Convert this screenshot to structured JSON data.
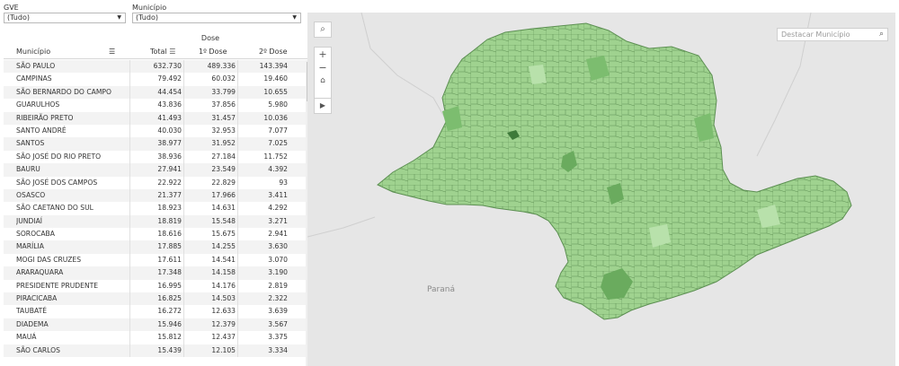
{
  "filters": {
    "gve": {
      "label": "GVE",
      "value": "(Tudo)"
    },
    "municipio": {
      "label": "Município",
      "value": "(Tudo)"
    }
  },
  "table": {
    "group_header": "Dose",
    "columns": {
      "name": "Município",
      "total": "Total",
      "dose1": "1º Dose",
      "dose2": "2º Dose"
    },
    "rows": [
      {
        "name": "SÃO PAULO",
        "total": "632.730",
        "d1": "489.336",
        "d2": "143.394"
      },
      {
        "name": "CAMPINAS",
        "total": "79.492",
        "d1": "60.032",
        "d2": "19.460"
      },
      {
        "name": "SÃO BERNARDO DO CAMPO",
        "total": "44.454",
        "d1": "33.799",
        "d2": "10.655"
      },
      {
        "name": "GUARULHOS",
        "total": "43.836",
        "d1": "37.856",
        "d2": "5.980"
      },
      {
        "name": "RIBEIRÃO PRETO",
        "total": "41.493",
        "d1": "31.457",
        "d2": "10.036"
      },
      {
        "name": "SANTO ANDRÉ",
        "total": "40.030",
        "d1": "32.953",
        "d2": "7.077"
      },
      {
        "name": "SANTOS",
        "total": "38.977",
        "d1": "31.952",
        "d2": "7.025"
      },
      {
        "name": "SÃO JOSÉ DO RIO PRETO",
        "total": "38.936",
        "d1": "27.184",
        "d2": "11.752"
      },
      {
        "name": "BAURU",
        "total": "27.941",
        "d1": "23.549",
        "d2": "4.392"
      },
      {
        "name": "SÃO JOSÉ DOS CAMPOS",
        "total": "22.922",
        "d1": "22.829",
        "d2": "93"
      },
      {
        "name": "OSASCO",
        "total": "21.377",
        "d1": "17.966",
        "d2": "3.411"
      },
      {
        "name": "SÃO CAETANO DO SUL",
        "total": "18.923",
        "d1": "14.631",
        "d2": "4.292"
      },
      {
        "name": "JUNDIAÍ",
        "total": "18.819",
        "d1": "15.548",
        "d2": "3.271"
      },
      {
        "name": "SOROCABA",
        "total": "18.616",
        "d1": "15.675",
        "d2": "2.941"
      },
      {
        "name": "MARÍLIA",
        "total": "17.885",
        "d1": "14.255",
        "d2": "3.630"
      },
      {
        "name": "MOGI DAS CRUZES",
        "total": "17.611",
        "d1": "14.541",
        "d2": "3.070"
      },
      {
        "name": "ARARAQUARA",
        "total": "17.348",
        "d1": "14.158",
        "d2": "3.190"
      },
      {
        "name": "PRESIDENTE PRUDENTE",
        "total": "16.995",
        "d1": "14.176",
        "d2": "2.819"
      },
      {
        "name": "PIRACICABA",
        "total": "16.825",
        "d1": "14.503",
        "d2": "2.322"
      },
      {
        "name": "TAUBATÉ",
        "total": "16.272",
        "d1": "12.633",
        "d2": "3.639"
      },
      {
        "name": "DIADEMA",
        "total": "15.946",
        "d1": "12.379",
        "d2": "3.567"
      },
      {
        "name": "MAUÁ",
        "total": "15.812",
        "d1": "12.437",
        "d2": "3.375"
      },
      {
        "name": "SÃO CARLOS",
        "total": "15.439",
        "d1": "12.105",
        "d2": "3.334"
      }
    ]
  },
  "map": {
    "search_placeholder": "Destacar Município",
    "region_label": "Paraná",
    "controls": [
      "search-icon",
      "zoom-in-icon",
      "zoom-out-icon",
      "home-icon",
      "play-icon"
    ],
    "colors": {
      "background": "#e6e6e6",
      "fill_light": "#a8d99a",
      "fill_mid": "#8ccb7e",
      "fill_dark": "#5aa04f",
      "border": "#4f7d47"
    }
  }
}
